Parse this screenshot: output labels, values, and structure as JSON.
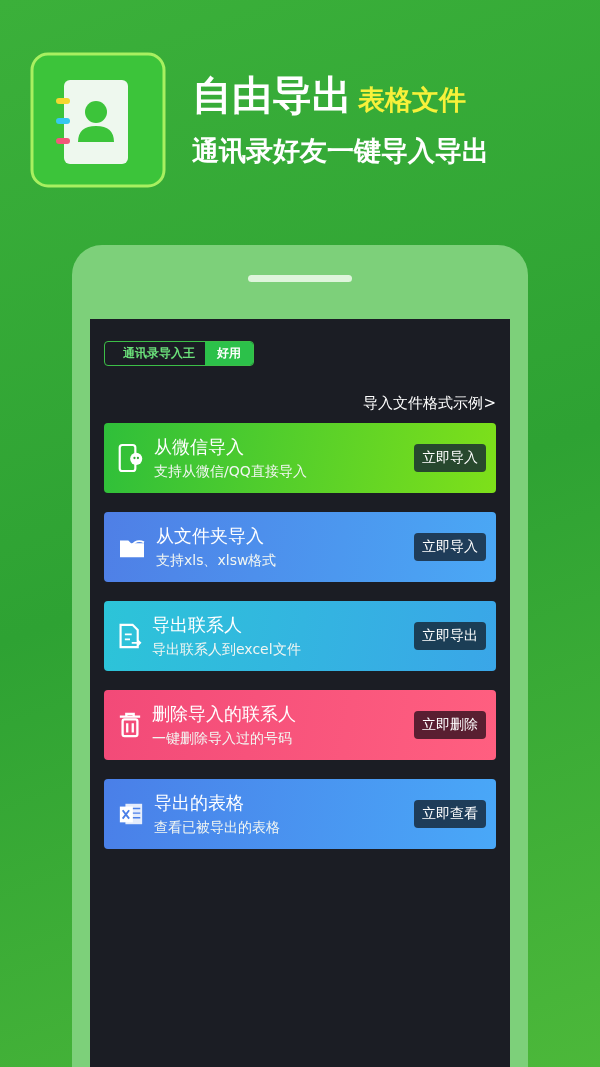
{
  "banner": {
    "title": "自由导出",
    "title_highlight": "表格文件",
    "subtitle": "通讯录好友一键导入导出"
  },
  "app_header": {
    "name": "通讯录导入王",
    "badge": "好用"
  },
  "format_link": "导入文件格式示例>",
  "actions": [
    {
      "kind": "wechat",
      "title": "从微信导入",
      "description": "支持从微信/QQ直接导入",
      "button": "立即导入",
      "color": "#2fbf3a"
    },
    {
      "kind": "folder",
      "title": "从文件夹导入",
      "description": "支持xls、xlsw格式",
      "button": "立即导入",
      "color": "#4f7fe6"
    },
    {
      "kind": "export",
      "title": "导出联系人",
      "description": "导出联系人到excel文件",
      "button": "立即导出",
      "color": "#2cc4d8"
    },
    {
      "kind": "delete",
      "title": "删除导入的联系人",
      "description": "一键删除导入过的号码",
      "button": "立即删除",
      "color": "#f24a78"
    },
    {
      "kind": "excel",
      "title": "导出的表格",
      "description": "查看已被导出的表格",
      "button": "立即查看",
      "color": "#4a7fe8"
    }
  ]
}
